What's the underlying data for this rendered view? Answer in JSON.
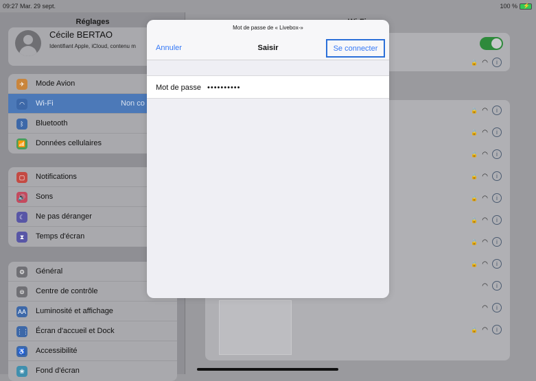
{
  "status_bar": {
    "time": "09:27  Mar. 29 sept.",
    "battery": "100 %"
  },
  "left_pane": {
    "title": "Réglages",
    "profile": {
      "name": "Cécile BERTAO",
      "subtitle": "Identifiant Apple, iCloud, contenu m"
    },
    "group1": [
      {
        "label": "Mode Avion",
        "icon": "airplane-icon",
        "color": "#ff9500"
      },
      {
        "label": "Wi-Fi",
        "icon": "wifi-icon",
        "color": "#3478f6",
        "value": "Non co",
        "selected": true
      },
      {
        "label": "Bluetooth",
        "icon": "bluetooth-icon",
        "color": "#3478f6"
      },
      {
        "label": "Données cellulaires",
        "icon": "cellular-icon",
        "color": "#34c759"
      }
    ],
    "group2": [
      {
        "label": "Notifications",
        "icon": "notifications-icon",
        "color": "#ff3b30"
      },
      {
        "label": "Sons",
        "icon": "sound-icon",
        "color": "#ff2d55"
      },
      {
        "label": "Ne pas déranger",
        "icon": "moon-icon",
        "color": "#5856d6"
      },
      {
        "label": "Temps d'écran",
        "icon": "hourglass-icon",
        "color": "#5856d6"
      }
    ],
    "group3": [
      {
        "label": "Général",
        "icon": "gear-icon",
        "color": "#8e8e93"
      },
      {
        "label": "Centre de contrôle",
        "icon": "control-center-icon",
        "color": "#8e8e93"
      },
      {
        "label": "Luminosité et affichage",
        "icon": "brightness-icon",
        "color": "#3478f6"
      },
      {
        "label": "Écran d'accueil et Dock",
        "icon": "home-screen-icon",
        "color": "#3478f6"
      },
      {
        "label": "Accessibilité",
        "icon": "accessibility-icon",
        "color": "#3478f6"
      },
      {
        "label": "Fond d'écran",
        "icon": "wallpaper-icon",
        "color": "#35aadc"
      }
    ]
  },
  "right_pane": {
    "title": "Wi-Fi"
  },
  "modal": {
    "prompt": "Mot de passe de « Livebox-»",
    "cancel_label": "Annuler",
    "title": "Saisir",
    "connect_label": "Se connecter",
    "password_label": "Mot de passe",
    "password_value": "••••••••••"
  }
}
